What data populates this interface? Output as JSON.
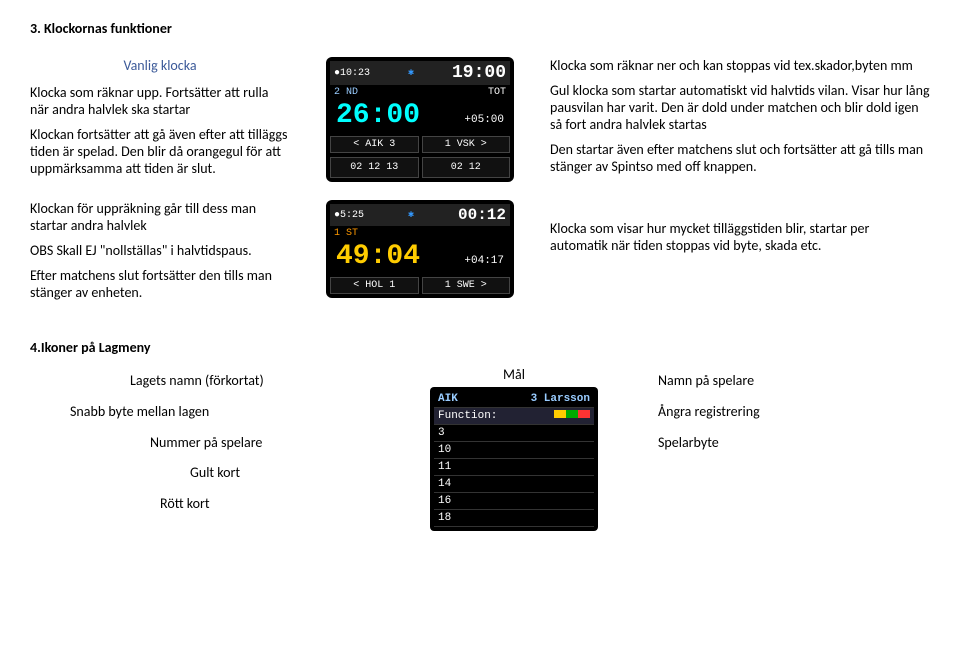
{
  "section3": {
    "title": "3. Klockornas funktioner",
    "vanlig": "Vanlig klocka",
    "left1": "Klocka som räknar upp. Fortsätter att rulla när andra halvlek ska startar",
    "left2": "Klockan fortsätter att gå även efter att tilläggs tiden är spelad. Den blir då orangegul för att uppmärksamma att tiden är slut.",
    "left3": "Klockan för uppräkning går till dess man startar andra halvlek",
    "left4": "OBS Skall EJ \"nollställas\" i halvtidspaus.",
    "left5": "Efter matchens slut fortsätter den tills man stänger av enheten.",
    "right1": "Klocka som räknar ner och kan stoppas vid tex.skador,byten mm",
    "right2": "Gul klocka som startar automatiskt vid halvtids vilan. Visar hur lång pausvilan har varit. Den är dold under matchen och blir dold igen så fort andra halvlek startas",
    "right3": "Den startar även efter  matchens slut och fortsätter att gå tills man stänger av Spintso med off knappen.",
    "right4": "Klocka som visar hur mycket tilläggstiden blir, startar per automatik när tiden stoppas vid byte, skada etc."
  },
  "device1": {
    "topbar_left": "●10:23",
    "topbar_right": "19:00",
    "half": "2 ND",
    "main_time": "26:00",
    "tot": "TOT",
    "sub_time": "+05:00",
    "score_left": "< AIK 3",
    "score_right": "1 VSK >",
    "g1": "02 12 13",
    "g2": "02 12"
  },
  "device2": {
    "topbar_left": "●5:25",
    "topbar_right": "00:12",
    "half": "1 ST",
    "main_time": "49:04",
    "sub_time": "+04:17",
    "score_left": "< HOL 1",
    "score_right": "1 SWE >"
  },
  "section4": {
    "title": "4.Ikoner på Lagmeny",
    "lagets_namn": "Lagets namn (förkortat)",
    "mal": "Mål",
    "snabb_byte": "Snabb byte mellan lagen",
    "nummer": "Nummer på spelare",
    "gult": "Gult kort",
    "rott": "Rött kort",
    "namn_spelare": "Namn på spelare",
    "angra": "Ångra registrering",
    "spelarbyte": "Spelarbyte"
  },
  "menutable": {
    "header_left": "AIK",
    "header_right": "3 Larsson",
    "function_label": "Function:",
    "rows": [
      "3",
      "10",
      "11",
      "14",
      "16",
      "18"
    ]
  }
}
